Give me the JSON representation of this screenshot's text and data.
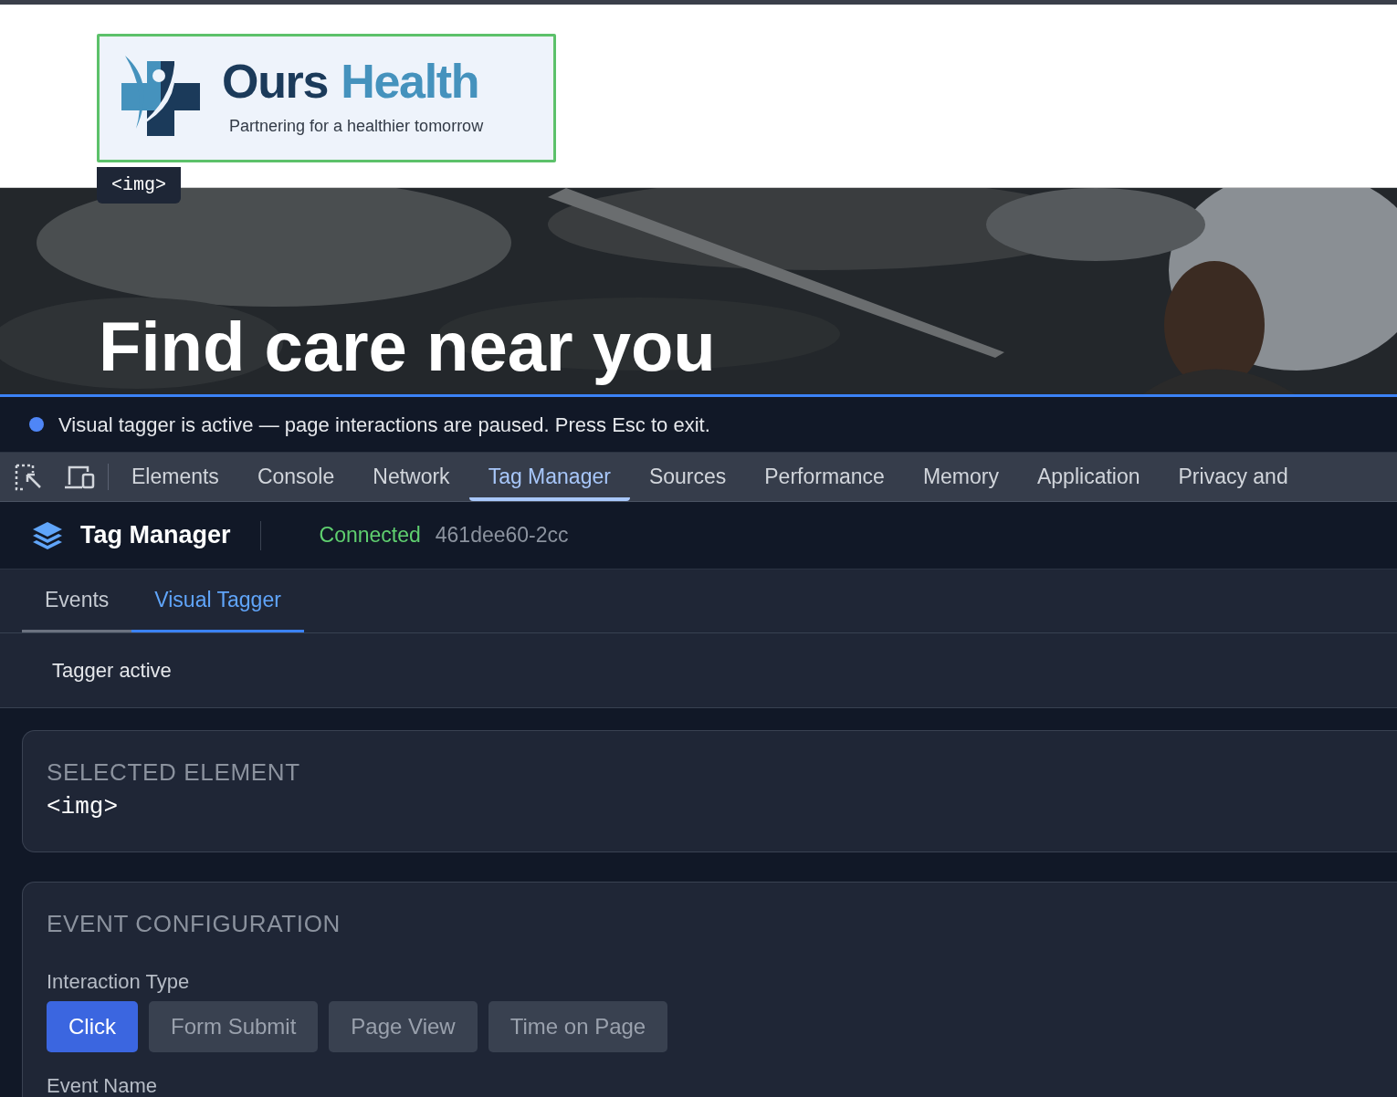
{
  "site_header": {
    "brand_first": "Ours",
    "brand_second": "Health",
    "tagline": "Partnering for a healthier tomorrow",
    "highlight_tag": "<img>"
  },
  "hero": {
    "title": "Find care near you"
  },
  "tagger_banner": {
    "text": "Visual tagger is active — page interactions are paused. Press Esc to exit."
  },
  "devtools_tabs": [
    {
      "label": "Elements",
      "selected": false
    },
    {
      "label": "Console",
      "selected": false
    },
    {
      "label": "Network",
      "selected": false
    },
    {
      "label": "Tag Manager",
      "selected": true
    },
    {
      "label": "Sources",
      "selected": false
    },
    {
      "label": "Performance",
      "selected": false
    },
    {
      "label": "Memory",
      "selected": false
    },
    {
      "label": "Application",
      "selected": false
    },
    {
      "label": "Privacy and",
      "selected": false
    }
  ],
  "panel_header": {
    "title": "Tag Manager",
    "status": "Connected",
    "session_id": "461dee60-2cc"
  },
  "sub_tabs": [
    {
      "label": "Events",
      "selected": false
    },
    {
      "label": "Visual Tagger",
      "selected": true
    }
  ],
  "tagger_status": "Tagger active",
  "selected_element": {
    "heading": "SELECTED ELEMENT",
    "value": "<img>"
  },
  "event_configuration": {
    "heading": "EVENT CONFIGURATION",
    "interaction_label": "Interaction Type",
    "interaction_types": [
      {
        "label": "Click",
        "selected": true
      },
      {
        "label": "Form Submit",
        "selected": false
      },
      {
        "label": "Page View",
        "selected": false
      },
      {
        "label": "Time on Page",
        "selected": false
      }
    ],
    "event_name_label": "Event Name"
  }
}
